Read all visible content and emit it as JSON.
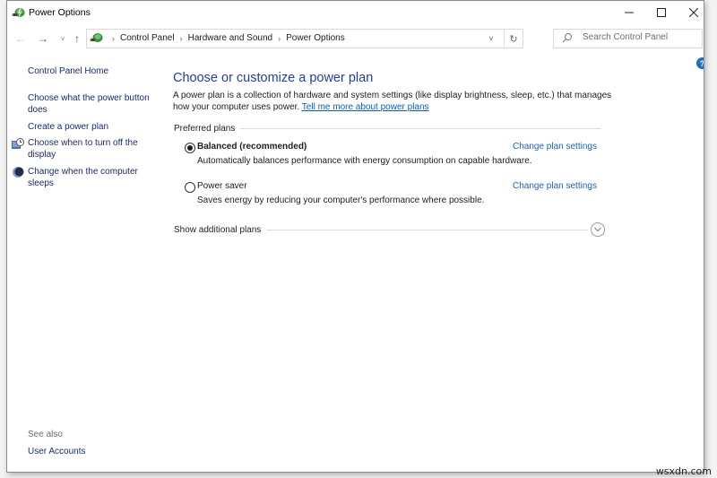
{
  "window": {
    "title": "Power Options",
    "controls": {
      "minimize": "—",
      "maximize": "☐",
      "close": "✕"
    }
  },
  "navbar": {
    "back_icon": "←",
    "forward_icon": "→",
    "recent_icon": "˅",
    "up_icon": "↑",
    "breadcrumbs": [
      "Control Panel",
      "Hardware and Sound",
      "Power Options"
    ],
    "breadcrumb_separator": "›",
    "dropdown_icon": "˅",
    "refresh_icon": "↻",
    "search": {
      "placeholder": "Search Control Panel",
      "value": ""
    }
  },
  "sidebar": {
    "home": "Control Panel Home",
    "tasks": [
      {
        "label": "Choose what the power button does",
        "icon": ""
      },
      {
        "label": "Create a power plan",
        "icon": ""
      },
      {
        "label": "Choose when to turn off the display",
        "icon": "display-clock-icon"
      },
      {
        "label": "Change when the computer sleeps",
        "icon": "moon-sleep-icon"
      }
    ],
    "see_also_label": "See also",
    "see_also_links": [
      "User Accounts"
    ]
  },
  "main": {
    "help_icon": "?",
    "heading": "Choose or customize a power plan",
    "description": "A power plan is a collection of hardware and system settings (like display brightness, sleep, etc.) that manages how your computer uses power.",
    "learn_more_link": "Tell me more about power plans",
    "group_label": "Preferred plans",
    "plans": [
      {
        "name": "Balanced (recommended)",
        "description": "Automatically balances performance with energy consumption on capable hardware.",
        "selected": true,
        "settings_link": "Change plan settings"
      },
      {
        "name": "Power saver",
        "description": "Saves energy by reducing your computer's performance where possible.",
        "selected": false,
        "settings_link": "Change plan settings"
      }
    ],
    "show_more_label": "Show additional plans"
  },
  "watermark": "wsxdn.com",
  "colors": {
    "link_dark": "#1c2a6b",
    "link_blue": "#1e62b8",
    "heading": "#21409a",
    "help_blue": "#1d6fc4"
  }
}
